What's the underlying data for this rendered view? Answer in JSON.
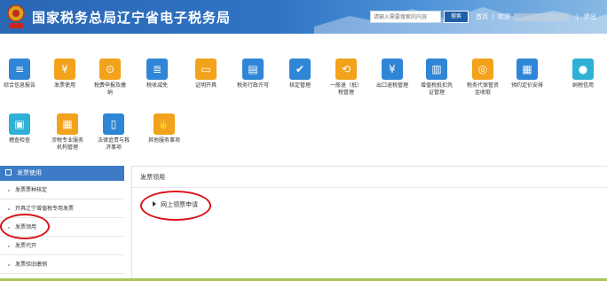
{
  "header": {
    "title": "国家税务总局辽宁省电子税务局",
    "search_placeholder": "请输入需要搜索的内容",
    "search_button": "搜索",
    "home_link": "首页",
    "welcome": "欢迎",
    "separator": "|",
    "logout": "退出",
    "colors": {
      "bar": "#2f74c4",
      "accent_red": "#d8131a"
    }
  },
  "functions_row1": [
    {
      "label": "综合信息报告",
      "icon": "report-icon",
      "color": "#2f86d6"
    },
    {
      "label": "发票使用",
      "icon": "invoice-icon",
      "color": "#f2a21b"
    },
    {
      "label": "税费申报及缴纳",
      "icon": "tax-payment-icon",
      "color": "#f2a21b"
    },
    {
      "label": "税收减免",
      "icon": "tax-relief-icon",
      "color": "#2f86d6"
    },
    {
      "label": "证明开具",
      "icon": "certificate-icon",
      "color": "#f2a21b"
    },
    {
      "label": "税务行政许可",
      "icon": "permit-icon",
      "color": "#2f86d6"
    },
    {
      "label": "核定管理",
      "icon": "assessment-icon",
      "color": "#2f86d6"
    },
    {
      "label": "一般退（抵）税管理",
      "icon": "refund-icon",
      "color": "#f2a21b"
    },
    {
      "label": "出口退税管理",
      "icon": "export-refund-icon",
      "color": "#2f86d6"
    },
    {
      "label": "增值税抵扣凭证管理",
      "icon": "vat-voucher-icon",
      "color": "#2f86d6"
    },
    {
      "label": "税务代保管资金收取",
      "icon": "custody-funds-icon",
      "color": "#f2a21b"
    },
    {
      "label": "预约定价安排",
      "icon": "pricing-icon",
      "color": "#2f86d6"
    },
    {
      "label": "纳税信用",
      "icon": "credit-icon",
      "color": "#2fb0d6"
    }
  ],
  "functions_row2": [
    {
      "label": "稽查检查",
      "icon": "inspection-icon",
      "color": "#2fb0d6"
    },
    {
      "label": "涉税专业服务机构管理",
      "icon": "agency-icon",
      "color": "#f2a21b"
    },
    {
      "label": "法律追责与救济事项",
      "icon": "law-icon",
      "color": "#2f86d6"
    },
    {
      "label": "其他服务事项",
      "icon": "handshake-icon",
      "color": "#f2a21b"
    }
  ],
  "sidebar": {
    "title": "发票使用",
    "items": [
      {
        "label": "发票票种核定"
      },
      {
        "label": "开具辽宁增值税专用发票"
      },
      {
        "label": "发票领用"
      },
      {
        "label": "发票代开"
      },
      {
        "label": "发票验旧缴销"
      }
    ]
  },
  "content": {
    "title": "发票领用",
    "link": "网上领票申请"
  }
}
